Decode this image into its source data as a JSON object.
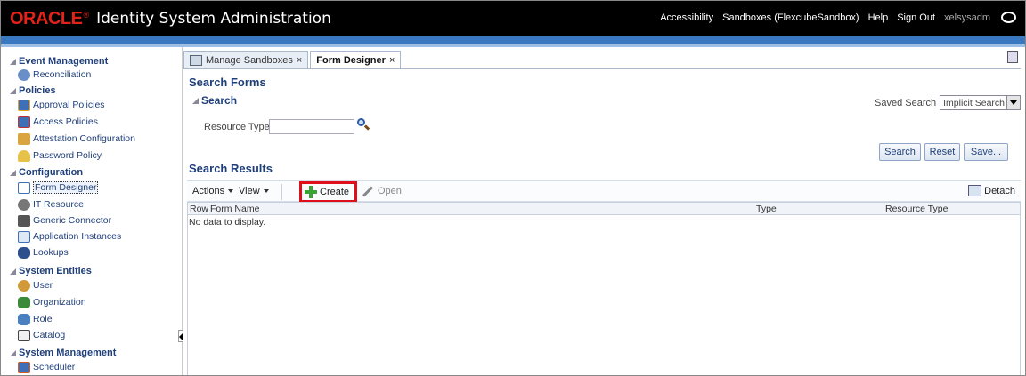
{
  "header": {
    "logo": "ORACLE",
    "app_title": "Identity System Administration",
    "links": [
      "Accessibility",
      "Sandboxes (FlexcubeSandbox)",
      "Help",
      "Sign Out"
    ],
    "user": "xelsysadm"
  },
  "sidebar": {
    "sections": [
      {
        "title": "Event Management",
        "items": [
          {
            "label": "Reconciliation",
            "icon": "reconciliation-icon"
          }
        ]
      },
      {
        "title": "Policies",
        "items": [
          {
            "label": "Approval Policies",
            "icon": "approval-policy-icon"
          },
          {
            "label": "Access Policies",
            "icon": "access-policy-icon"
          },
          {
            "label": "Attestation Configuration",
            "icon": "attestation-icon"
          },
          {
            "label": "Password Policy",
            "icon": "password-policy-icon"
          }
        ]
      },
      {
        "title": "Configuration",
        "items": [
          {
            "label": "Form Designer",
            "icon": "form-designer-icon"
          },
          {
            "label": "IT Resource",
            "icon": "it-resource-icon"
          },
          {
            "label": "Generic Connector",
            "icon": "connector-icon"
          },
          {
            "label": "Application Instances",
            "icon": "application-icon"
          },
          {
            "label": "Lookups",
            "icon": "lookups-icon"
          }
        ]
      },
      {
        "title": "System Entities",
        "items": [
          {
            "label": "User",
            "icon": "user-icon"
          },
          {
            "label": "Organization",
            "icon": "organization-icon"
          },
          {
            "label": "Role",
            "icon": "role-icon"
          },
          {
            "label": "Catalog",
            "icon": "catalog-icon"
          }
        ]
      },
      {
        "title": "System Management",
        "items": [
          {
            "label": "Scheduler",
            "icon": "scheduler-icon"
          }
        ]
      }
    ]
  },
  "tabs": [
    {
      "label": "Manage Sandboxes",
      "close": "×"
    },
    {
      "label": "Form Designer",
      "close": "×"
    }
  ],
  "main": {
    "search_forms_title": "Search Forms",
    "search_title": "Search",
    "saved_search_label": "Saved Search",
    "saved_search_value": "Implicit Search",
    "resource_type_label": "Resource Type",
    "resource_type_value": "",
    "buttons": {
      "search": "Search",
      "reset": "Reset",
      "save": "Save..."
    },
    "results_title": "Search Results",
    "toolbar": {
      "actions": "Actions",
      "view": "View",
      "create": "Create",
      "open": "Open",
      "detach": "Detach"
    },
    "columns": [
      "Row",
      "Form Name",
      "Type",
      "Resource Type"
    ],
    "empty_text": "No data to display."
  },
  "colors": {
    "header_bg": "#000000",
    "oracle_red": "#e2231a",
    "blue_bar": "#3b78c2",
    "link_blue": "#1f3f7a",
    "highlight": "#e0101a"
  }
}
